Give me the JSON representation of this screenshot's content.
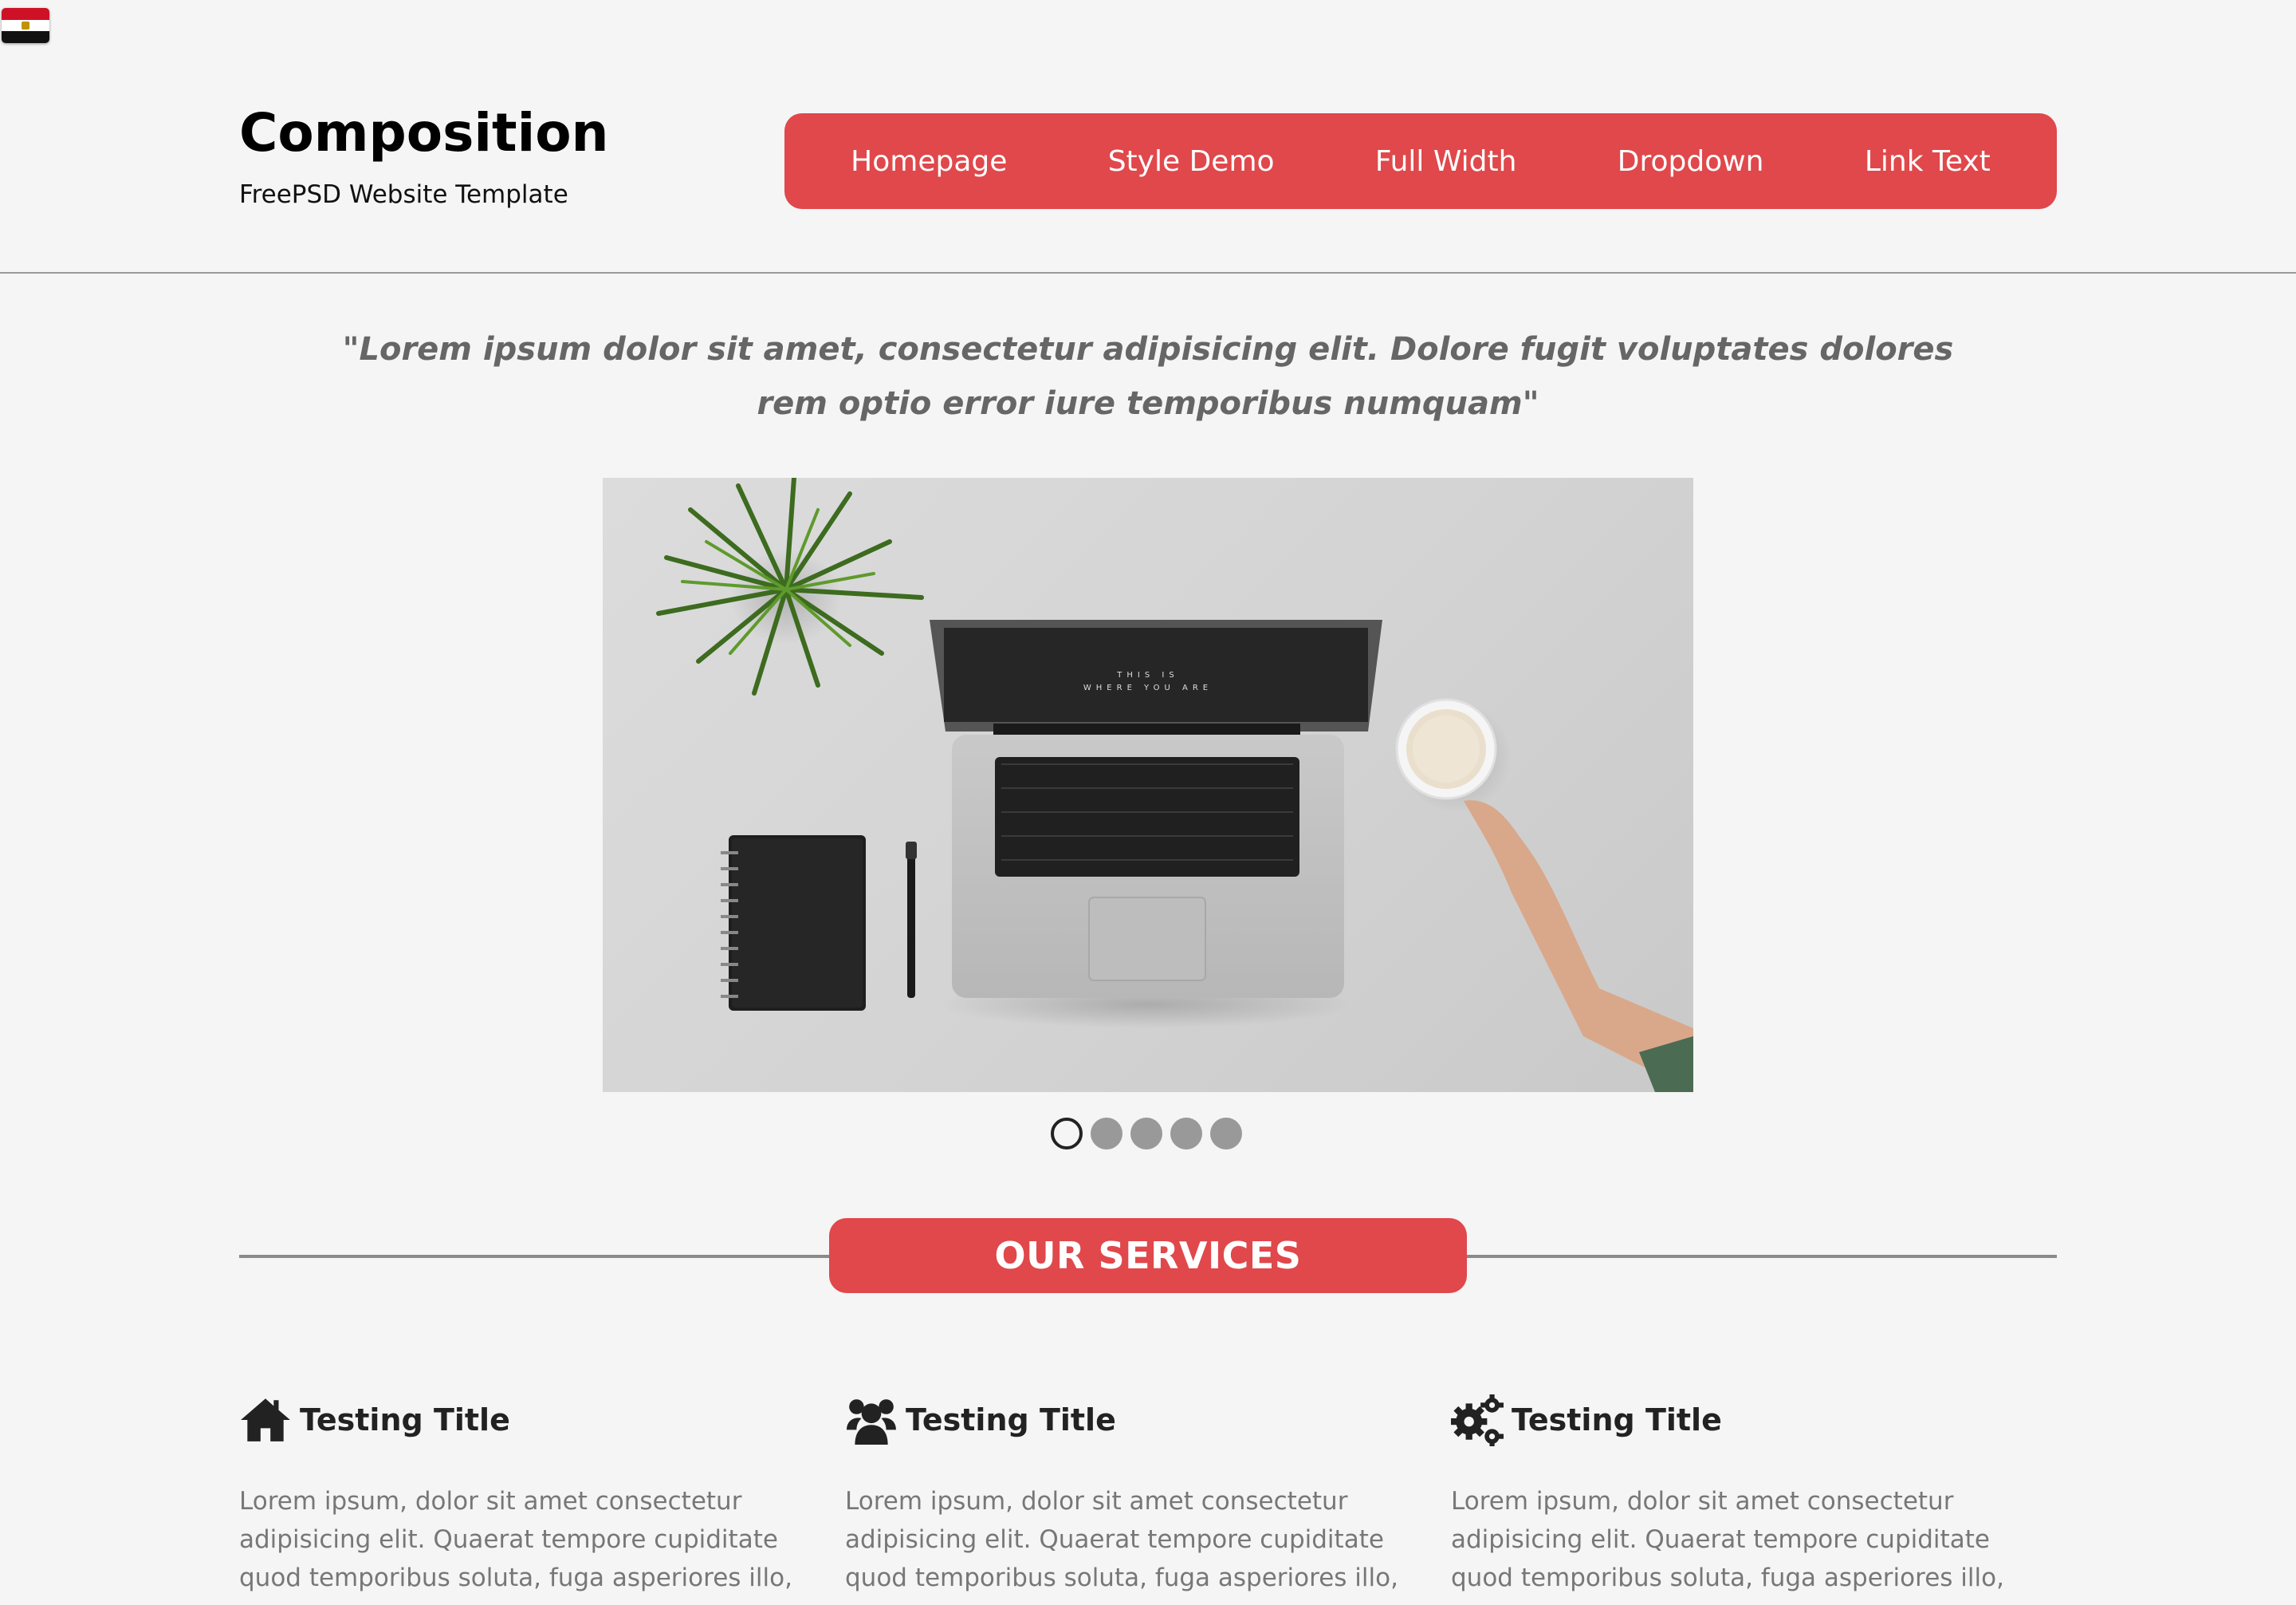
{
  "header": {
    "title": "Composition",
    "subtitle": "FreePSD Website Template"
  },
  "nav": {
    "items": [
      {
        "label": "Homepage"
      },
      {
        "label": "Style Demo"
      },
      {
        "label": "Full Width"
      },
      {
        "label": "Dropdown"
      },
      {
        "label": "Link Text"
      }
    ]
  },
  "quote": {
    "line1": "\"Lorem ipsum dolor sit amet, consectetur adipisicing elit. Dolore fugit voluptates dolores",
    "line2": "rem optio error iure temporibus numquam\""
  },
  "hero": {
    "screen_text_1": "THIS IS",
    "screen_text_2": "WHERE YOU ARE"
  },
  "slider": {
    "count": 5,
    "active_index": 0
  },
  "services": {
    "heading": "OUR SERVICES",
    "items": [
      {
        "icon": "home-icon",
        "title": "Testing Title",
        "text": "Lorem ipsum, dolor sit amet consectetur adipisicing elit. Quaerat tempore cupiditate quod temporibus soluta, fuga asperiores illo, earum at doloribus architecto officiis! Nemo impedit"
      },
      {
        "icon": "users-icon",
        "title": "Testing Title",
        "text": "Lorem ipsum, dolor sit amet consectetur adipisicing elit. Quaerat tempore cupiditate quod temporibus soluta, fuga asperiores illo, earum at doloribus architecto officiis! Nemo impedit"
      },
      {
        "icon": "gears-icon",
        "title": "Testing Title",
        "text": "Lorem ipsum, dolor sit amet consectetur adipisicing elit. Quaerat tempore cupiditate quod temporibus soluta, fuga asperiores illo, earum at doloribus architecto officiis! Nemo impedit"
      }
    ]
  },
  "colors": {
    "accent": "#e0484b",
    "background": "#f5f5f5"
  }
}
